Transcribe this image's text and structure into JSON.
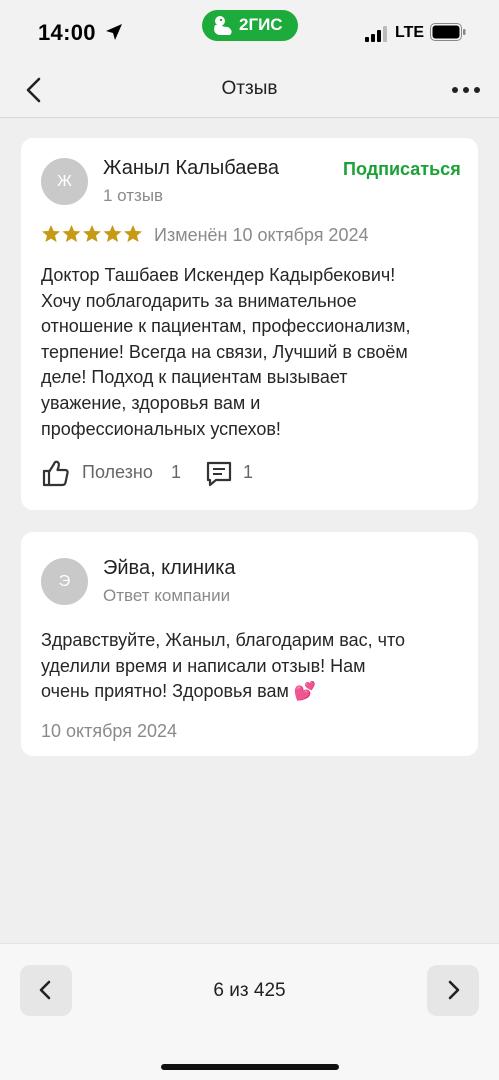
{
  "status_bar": {
    "time": "14:00",
    "network": "LTE",
    "app_badge": "2ГИС"
  },
  "nav": {
    "title": "Отзыв"
  },
  "review": {
    "avatar_letter": "Ж",
    "author": "Жаныл Калыбаева",
    "reviews_count": "1 отзыв",
    "subscribe_label": "Подписаться",
    "rating": 5,
    "edited": "Изменён 10 октября 2024",
    "text_lines": [
      "Доктор Ташбаев Искендер Кадырбекович!",
      "Хочу поблагодарить за внимательное",
      "отношение к пациентам, профессионализм,",
      "терпение! Всегда на связи, Лучший в своём",
      "деле! Подход к пациентам вызывает",
      "уважение, здоровья вам и",
      "профессиональных успехов!"
    ],
    "like_label": "Полезно",
    "like_count": "1",
    "comment_count": "1"
  },
  "answer": {
    "avatar_letter": "Э",
    "author": "Эйва, клиника",
    "role": "Ответ компании",
    "text_lines": [
      "Здравствуйте, Жаныл, благодарим вас, что",
      "уделили время и написали отзыв! Нам",
      "очень приятно! Здоровья вам 💕"
    ],
    "date": "10 октября 2024"
  },
  "pagination": {
    "label": "6 из 425"
  },
  "colors": {
    "accent_green": "#1ba136",
    "star_gold": "#c69a14",
    "brand_green": "#1dab3c"
  }
}
